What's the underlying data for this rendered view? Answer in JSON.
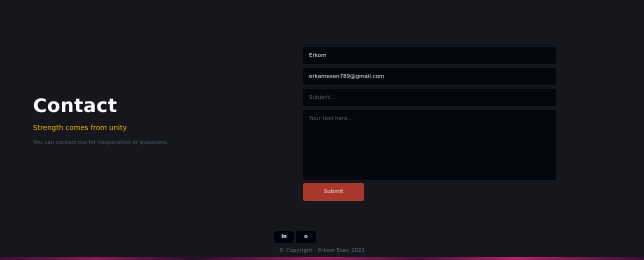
{
  "contact": {
    "title": "Contact",
    "subtitle": "Strength comes from unity",
    "description": "You can contact me for cooperation or questions."
  },
  "form": {
    "name_value": "Erkom",
    "email_value": "erkamesen789@gmail.com",
    "subject_placeholder": "Subject...",
    "message_placeholder": "Your text here...",
    "submit_label": "Submit"
  },
  "footer": {
    "social": [
      {
        "icon": "linkedin-icon",
        "glyph": "in"
      },
      {
        "icon": "github-icon",
        "glyph": "⊙"
      }
    ],
    "copyright": "© Copyright - Erkom Esen 2023"
  },
  "colors": {
    "background": "#15171c",
    "accent": "#f0b400",
    "submit": "#a8382c",
    "field": "#040610"
  }
}
